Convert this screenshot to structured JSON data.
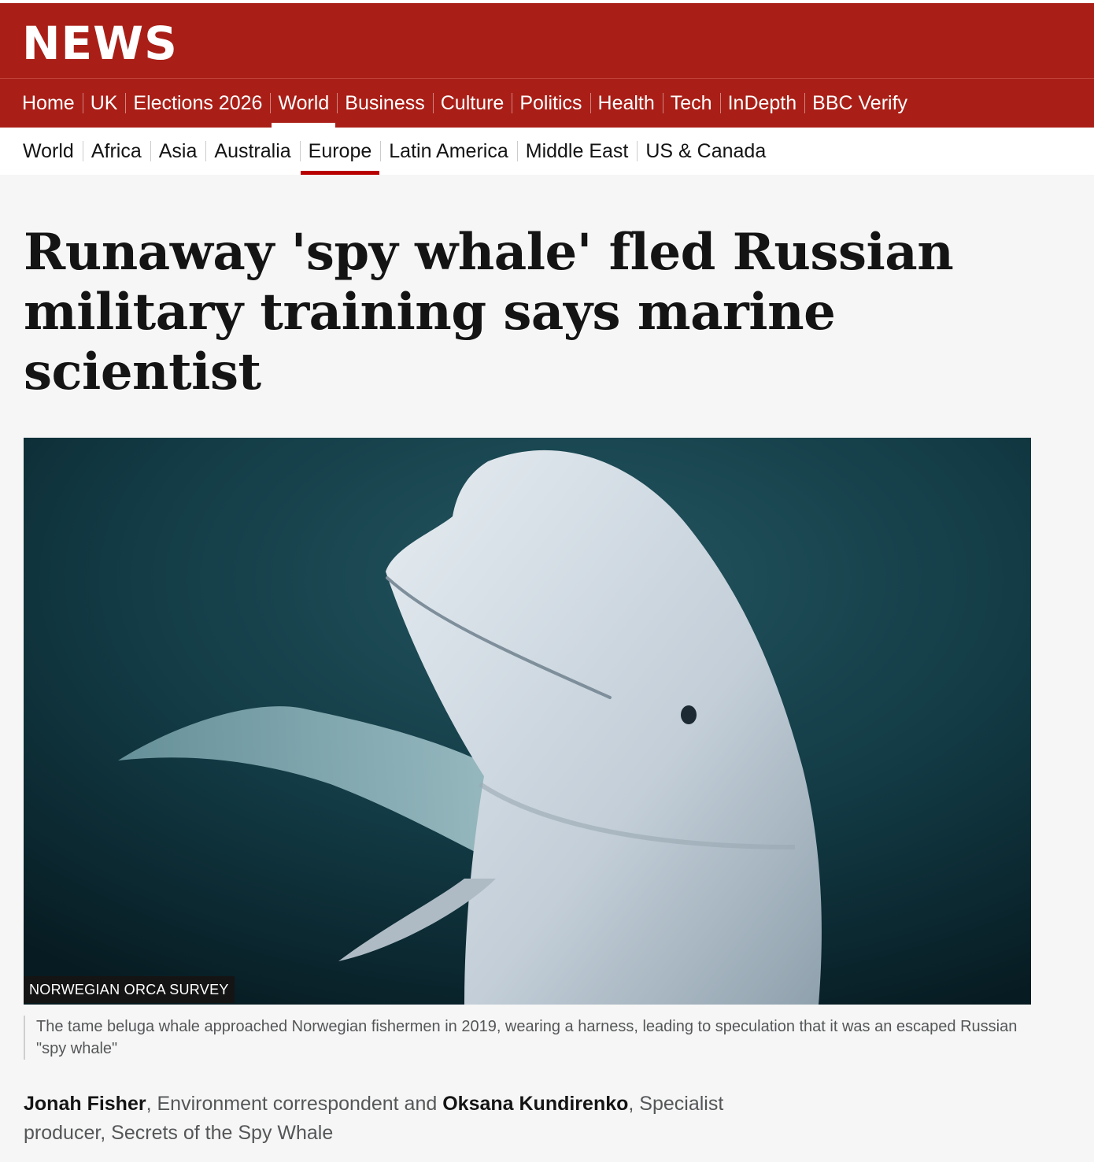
{
  "brand": {
    "logo": "NEWS"
  },
  "primary_nav": {
    "items": [
      "Home",
      "UK",
      "Elections 2026",
      "World",
      "Business",
      "Culture",
      "Politics",
      "Health",
      "Tech",
      "InDepth",
      "BBC Verify"
    ],
    "active": "World"
  },
  "secondary_nav": {
    "items": [
      "World",
      "Africa",
      "Asia",
      "Australia",
      "Europe",
      "Latin America",
      "Middle East",
      "US & Canada"
    ],
    "active": "Europe"
  },
  "article": {
    "headline": "Runaway 'spy whale' fled Russian military training says marine scientist",
    "image": {
      "credit": "NORWEGIAN ORCA SURVEY",
      "caption": "The tame beluga whale approached Norwegian fishermen in 2019, wearing a harness, leading to speculation that it was an escaped Russian \"spy whale\""
    },
    "byline": {
      "author1": "Jonah Fisher",
      "role1": ", Environment correspondent and ",
      "author2": "Oksana Kundirenko",
      "role2": ", Specialist producer, Secrets of the Spy Whale"
    }
  },
  "colors": {
    "brand_red": "#a91f17",
    "active_underline": "#b80000",
    "water_dark": "#0c2a32"
  }
}
